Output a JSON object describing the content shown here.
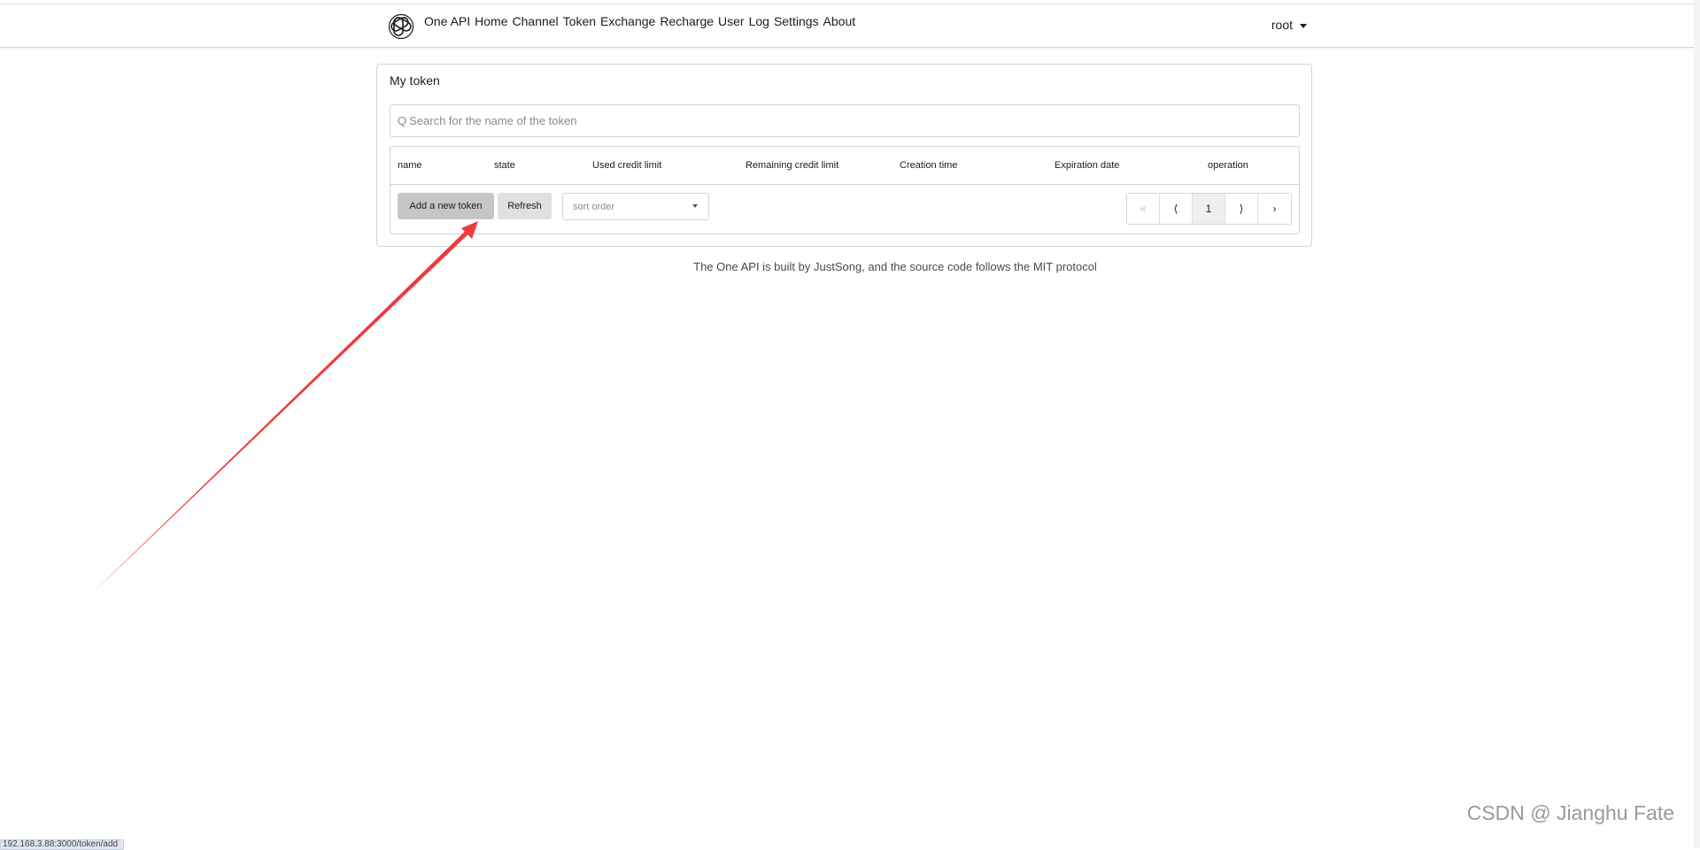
{
  "nav": {
    "brand": "One API",
    "links": [
      "Home",
      "Channel",
      "Token",
      "Exchange",
      "Recharge",
      "User",
      "Log",
      "Settings",
      "About"
    ],
    "user": "root"
  },
  "card": {
    "title": "My token",
    "search": {
      "icon": "Q",
      "placeholder": "Search for the name of the token"
    },
    "table": {
      "columns": [
        "name",
        "state",
        "Used credit limit",
        "Remaining credit limit",
        "Creation time",
        "Expiration date",
        "operation"
      ]
    },
    "actions": {
      "add_label": "Add a new token",
      "refresh_label": "Refresh",
      "sort_placeholder": "sort order"
    },
    "pagination": {
      "first": "«",
      "prev": "⟨",
      "current": "1",
      "next": "⟩",
      "last": "›"
    }
  },
  "footer": "The One API is built by JustSong, and the source code follows the MIT protocol",
  "watermark": "CSDN @ Jianghu Fate",
  "status_url": "192.168.3.88:3000/token/add",
  "colors": {
    "arrow": "#ee3b3b",
    "add_button": "#c6c6c6",
    "refresh_button": "#e0e0e0"
  }
}
